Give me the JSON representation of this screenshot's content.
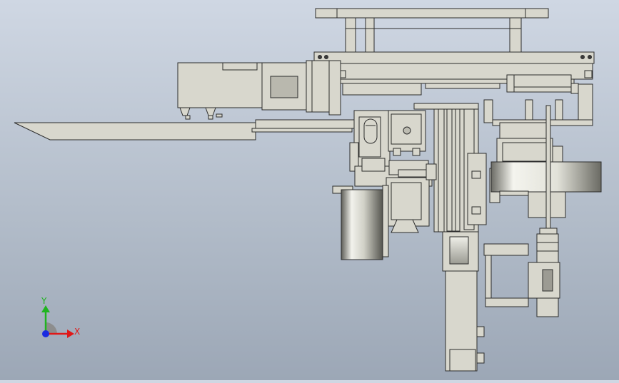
{
  "viewport": {
    "background_top": "#cfd7e3",
    "background_bottom": "#9ca7b6",
    "part_fill": "#d8d7cd",
    "part_stroke": "#2c2c2c"
  },
  "triad": {
    "x_label": "X",
    "y_label": "Y",
    "x_color": "#e01818",
    "y_color": "#1fb41f",
    "z_color": "#1b2be0"
  }
}
